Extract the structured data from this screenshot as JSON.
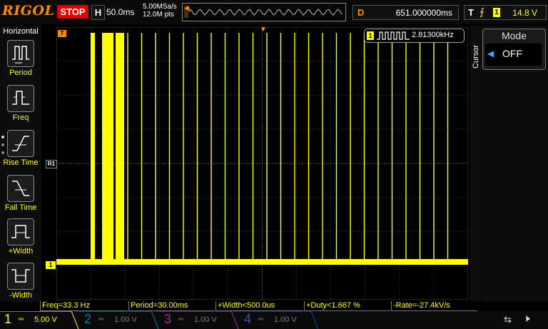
{
  "topbar": {
    "logo": "RIGOL",
    "run_state": "STOP",
    "timebase_label": "H",
    "timebase_value": "50.0ms",
    "sample_rate": "5.00MSa/s",
    "mem_depth": "12.0M pts",
    "delay_label": "D",
    "delay_value": "651.000000ms",
    "trigger_label": "T",
    "trigger_channel": "1",
    "trigger_level": "14.8 V"
  },
  "left_menu": {
    "title": "Horizontal",
    "items": [
      {
        "label": "Period",
        "icon": "period-icon"
      },
      {
        "label": "Freq",
        "icon": "freq-icon"
      },
      {
        "label": "Rise Time",
        "icon": "rise-time-icon"
      },
      {
        "label": "Fall Time",
        "icon": "fall-time-icon"
      },
      {
        "label": "+Width",
        "icon": "positive-width-icon"
      },
      {
        "label": "-Width",
        "icon": "negative-width-icon"
      }
    ]
  },
  "screen": {
    "trigger_marker": "T",
    "ref_marker": "R1",
    "ch1_marker": "1",
    "trigger_level_marker": "T"
  },
  "counter": {
    "channel": "1",
    "value": "2.81300kHz"
  },
  "right_menu": {
    "side_label": "Cursor",
    "mode_title": "Mode",
    "mode_value": "OFF"
  },
  "measurements": [
    {
      "text": "Freq=33.3 Hz"
    },
    {
      "text": "Period=30.00ms"
    },
    {
      "text": "+Width<500.0us"
    },
    {
      "text": "+Duty<1.667 %"
    },
    {
      "text": "-Rate=-27.4kV/s"
    }
  ],
  "channels": [
    {
      "num": "1",
      "scale": "5.00 V",
      "color": "#ffff00",
      "active": true
    },
    {
      "num": "2",
      "scale": "1.00 V",
      "color": "#00c8ff",
      "active": false
    },
    {
      "num": "3",
      "scale": "1.00 V",
      "color": "#ff40ff",
      "active": false
    },
    {
      "num": "4",
      "scale": "1.00 V",
      "color": "#3060ff",
      "active": false
    }
  ],
  "colors": {
    "trace": "#ffff00",
    "accent": "#ff8a00",
    "stop": "#e00000"
  }
}
